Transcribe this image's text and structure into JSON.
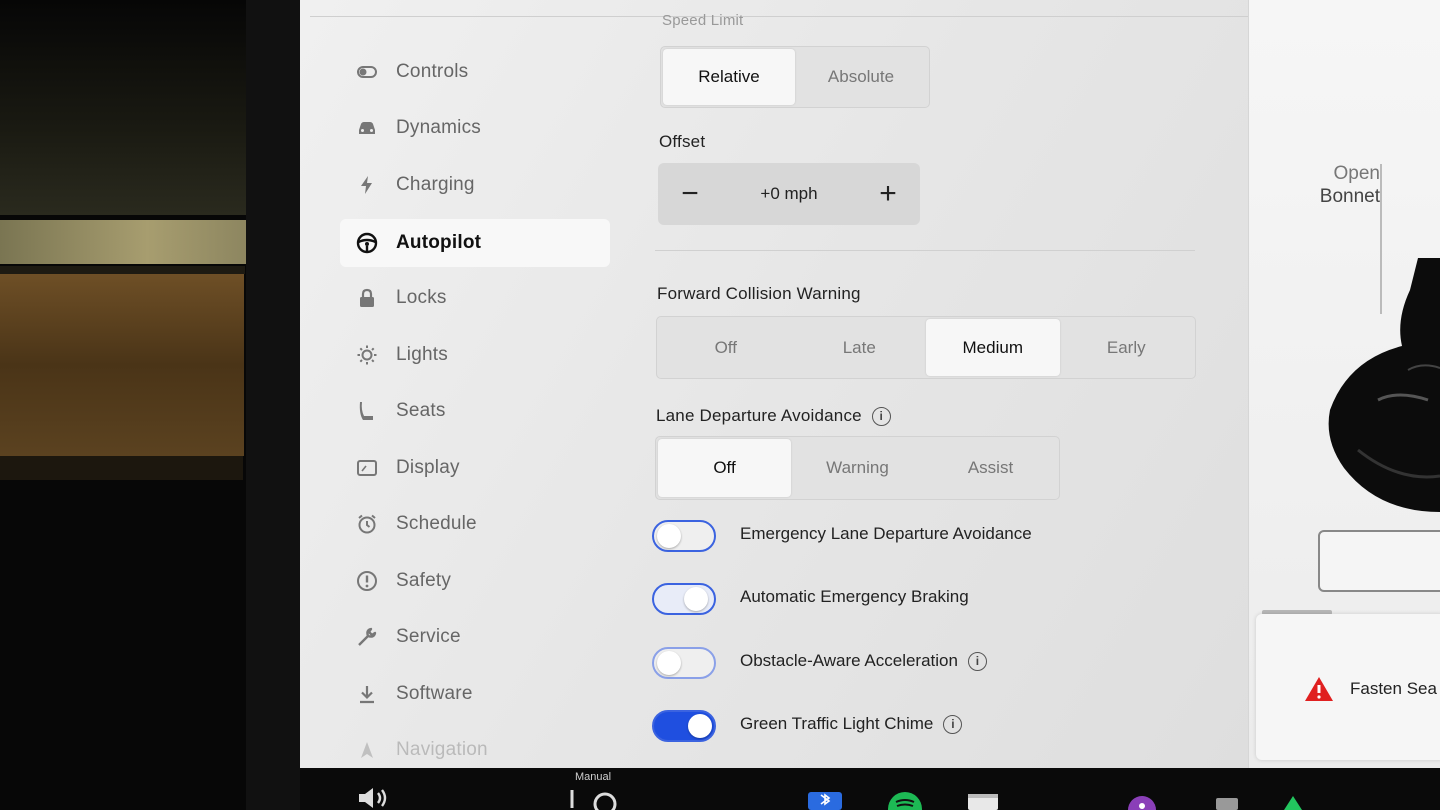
{
  "sidebar": {
    "items": [
      {
        "label": "Controls",
        "icon": "toggle-icon"
      },
      {
        "label": "Dynamics",
        "icon": "car-icon"
      },
      {
        "label": "Charging",
        "icon": "bolt-icon"
      },
      {
        "label": "Autopilot",
        "icon": "steering-wheel-icon",
        "active": true
      },
      {
        "label": "Locks",
        "icon": "lock-icon"
      },
      {
        "label": "Lights",
        "icon": "sun-icon"
      },
      {
        "label": "Seats",
        "icon": "seat-icon"
      },
      {
        "label": "Display",
        "icon": "display-icon"
      },
      {
        "label": "Schedule",
        "icon": "alarm-clock-icon"
      },
      {
        "label": "Safety",
        "icon": "alert-circle-icon"
      },
      {
        "label": "Service",
        "icon": "wrench-icon"
      },
      {
        "label": "Software",
        "icon": "download-icon"
      },
      {
        "label": "Navigation",
        "icon": "navigation-icon"
      }
    ]
  },
  "speed_limit": {
    "label": "Speed Limit",
    "options": [
      "Relative",
      "Absolute"
    ],
    "selected": "Relative"
  },
  "offset": {
    "label": "Offset",
    "value": "+0 mph",
    "minus": "−",
    "plus": "+"
  },
  "forward_collision": {
    "label": "Forward Collision Warning",
    "options": [
      "Off",
      "Late",
      "Medium",
      "Early"
    ],
    "selected": "Medium"
  },
  "lane_departure": {
    "label": "Lane Departure Avoidance",
    "options": [
      "Off",
      "Warning",
      "Assist"
    ],
    "selected": "Off"
  },
  "toggles": [
    {
      "label": "Emergency Lane Departure Avoidance",
      "on": false,
      "info": false
    },
    {
      "label": "Automatic Emergency Braking",
      "on": false,
      "info": false
    },
    {
      "label": "Obstacle-Aware Acceleration",
      "on": false,
      "info": true
    },
    {
      "label": "Green Traffic Light Chime",
      "on": true,
      "info": true
    }
  ],
  "right_panel": {
    "open_word": "Open",
    "bonnet_word": "Bonnet",
    "alert_text": "Fasten Sea"
  },
  "bottom_bar": {
    "mode_label": "Manual"
  },
  "colors": {
    "accent": "#1f4fe0",
    "warning": "#e02020"
  }
}
